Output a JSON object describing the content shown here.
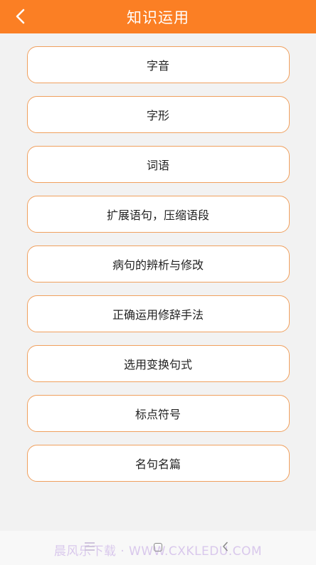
{
  "header": {
    "title": "知识运用",
    "back_icon": "chevron-left-icon"
  },
  "items": [
    {
      "label": "字音"
    },
    {
      "label": "字形"
    },
    {
      "label": "词语"
    },
    {
      "label": "扩展语句，压缩语段"
    },
    {
      "label": "病句的辨析与修改"
    },
    {
      "label": "正确运用修辞手法"
    },
    {
      "label": "选用变换句式"
    },
    {
      "label": "标点符号"
    },
    {
      "label": "名句名篇"
    }
  ],
  "navbar": {
    "watermark": "晨风乐下载 · WWW.CXKLEDU.COM"
  },
  "colors": {
    "accent": "#fb7f24",
    "item_border": "#f0a05e",
    "background": "#f2f2f2"
  }
}
